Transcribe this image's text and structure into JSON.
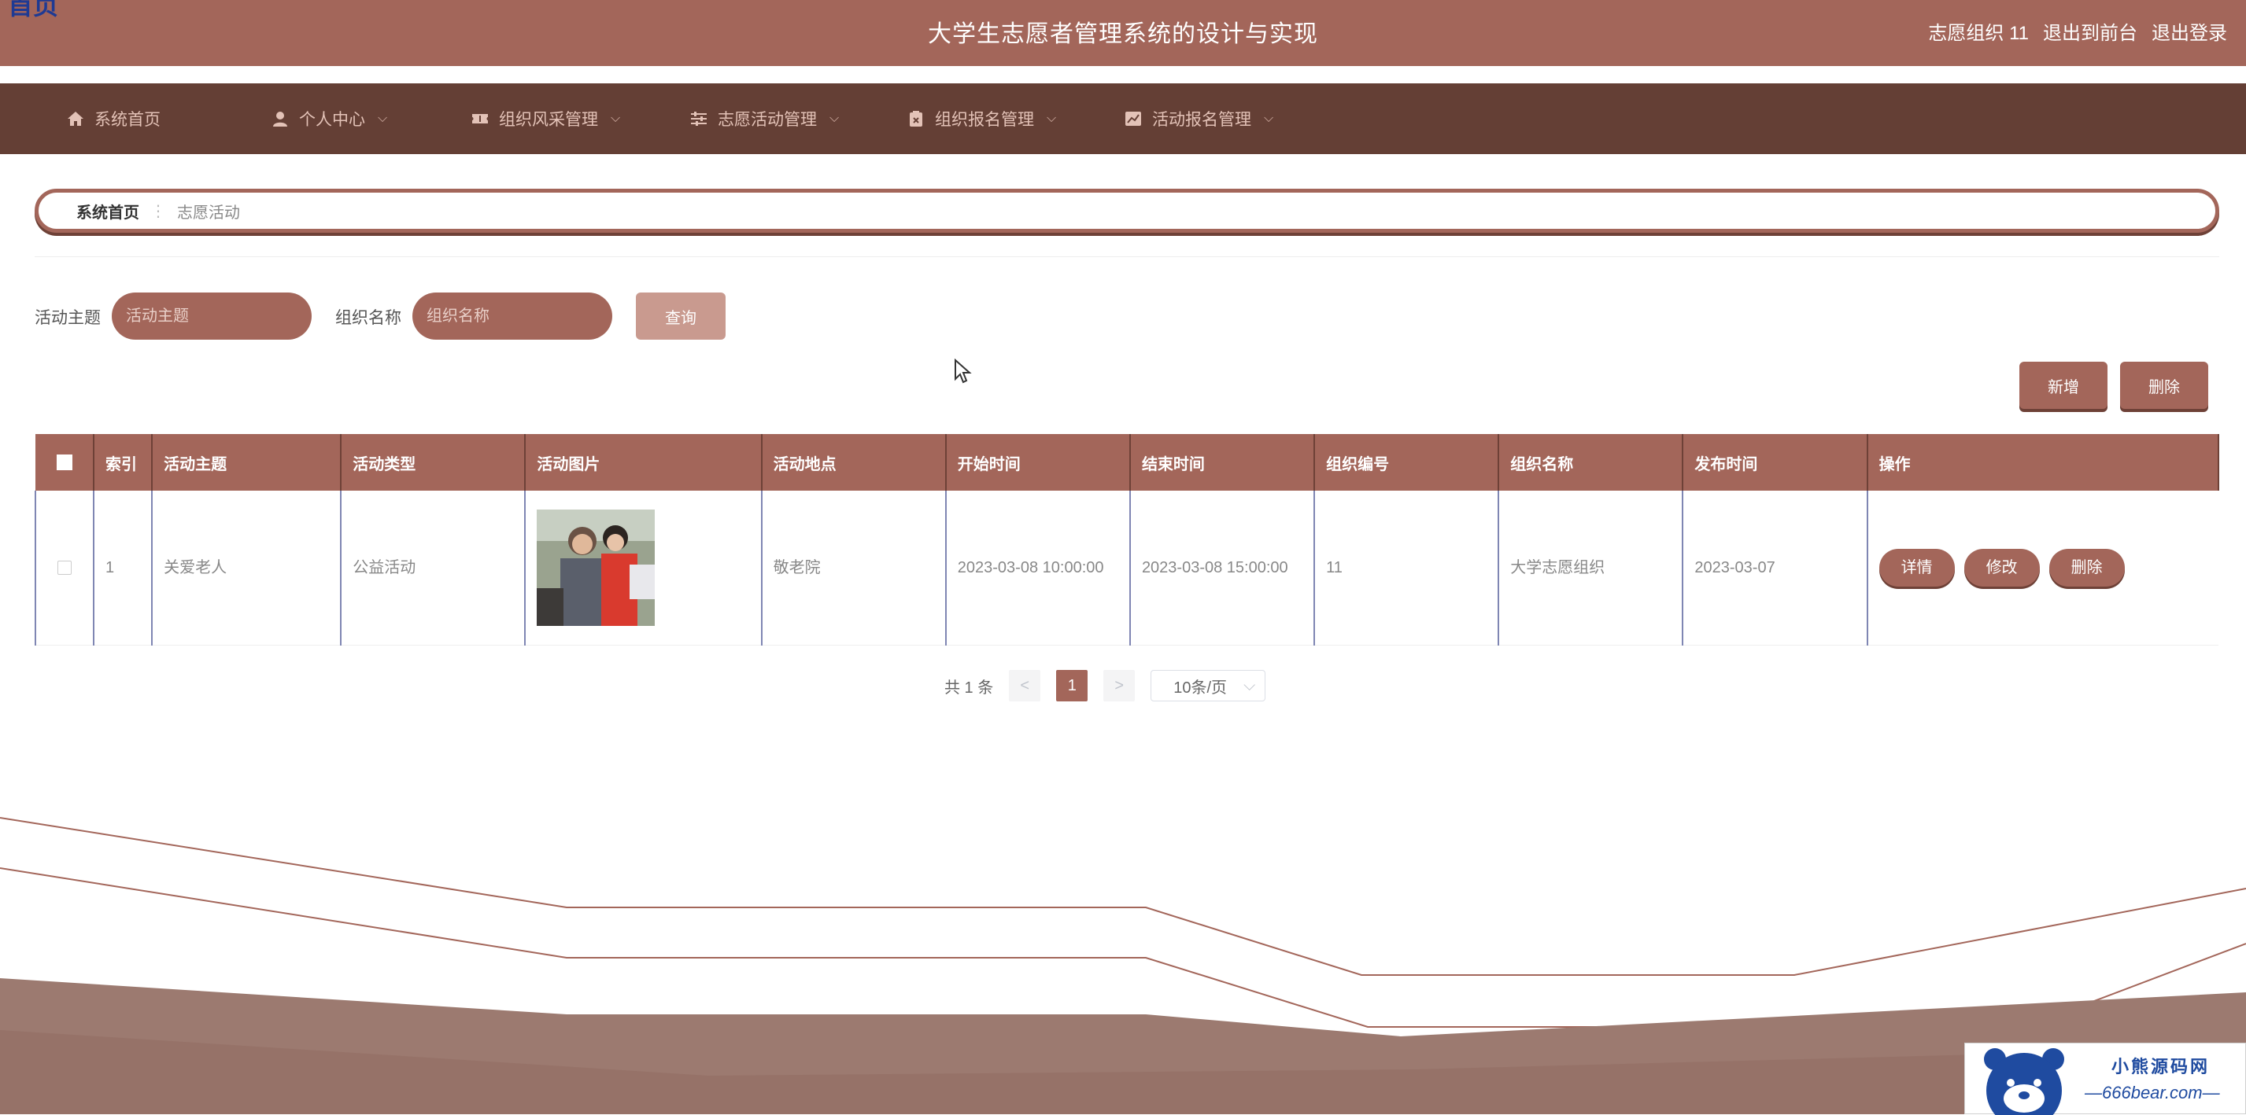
{
  "header": {
    "corner_text": "首页",
    "title": "大学生志愿者管理系统的设计与实现",
    "user": "志愿组织 11",
    "to_front": "退出到前台",
    "logout": "退出登录"
  },
  "nav": {
    "items": [
      {
        "label": "系统首页",
        "icon": "home-icon",
        "dropdown": false
      },
      {
        "label": "个人中心",
        "icon": "user-icon",
        "dropdown": true
      },
      {
        "label": "组织风采管理",
        "icon": "ticket-icon",
        "dropdown": true
      },
      {
        "label": "志愿活动管理",
        "icon": "sliders-icon",
        "dropdown": true
      },
      {
        "label": "组织报名管理",
        "icon": "clipboard-icon",
        "dropdown": true
      },
      {
        "label": "活动报名管理",
        "icon": "chart-icon",
        "dropdown": true
      }
    ]
  },
  "breadcrumb": {
    "home": "系统首页",
    "separator": "⋮",
    "current": "志愿活动"
  },
  "search": {
    "theme_label": "活动主题",
    "theme_placeholder": "活动主题",
    "org_label": "组织名称",
    "org_placeholder": "组织名称",
    "query_button": "查询"
  },
  "actions": {
    "add": "新增",
    "delete": "删除"
  },
  "table": {
    "headers": [
      "索引",
      "活动主题",
      "活动类型",
      "活动图片",
      "活动地点",
      "开始时间",
      "结束时间",
      "组织编号",
      "组织名称",
      "发布时间",
      "操作"
    ],
    "rows": [
      {
        "index": "1",
        "theme": "关爱老人",
        "type": "公益活动",
        "image": "volunteer-elderly-photo",
        "location": "敬老院",
        "start": "2023-03-08 10:00:00",
        "end": "2023-03-08 15:00:00",
        "org_no": "11",
        "org_name": "大学志愿组织",
        "publish": "2023-03-07",
        "btn_detail": "详情",
        "btn_edit": "修改",
        "btn_delete": "删除"
      }
    ]
  },
  "pagination": {
    "total": "共 1 条",
    "prev": "<",
    "current": "1",
    "next": ">",
    "page_size": "10条/页"
  },
  "watermark": {
    "title": "小熊源码网",
    "subtitle": "—666bear.com—"
  },
  "colors": {
    "primary": "#a3665a",
    "nav_bg": "#643f35",
    "accent_dark": "#6e4137"
  }
}
